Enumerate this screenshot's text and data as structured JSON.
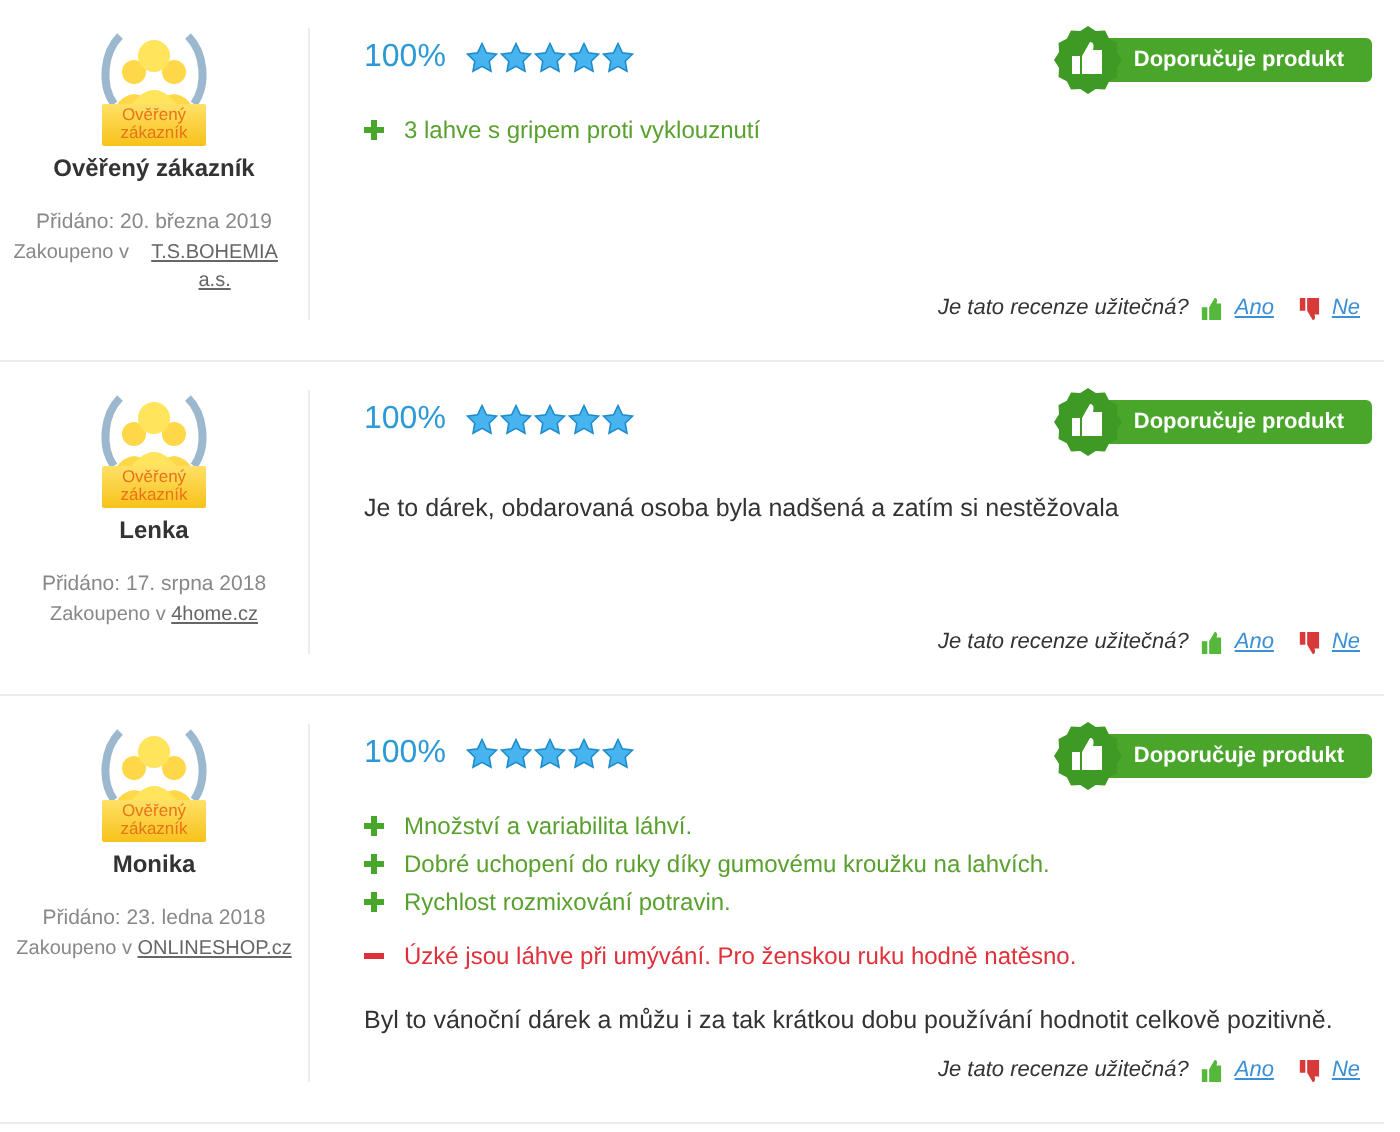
{
  "reviews": [
    {
      "badge_label": "Ověřený zákazník",
      "name": "Ověřený zákazník",
      "added": "Přidáno: 20. března 2019",
      "shop_prefix": "Zakoupeno v",
      "shop": "T.S.BOHEMIA a.s.",
      "score": "100%",
      "stars": 5,
      "recommend": "Doporučuje produkt",
      "points": [
        {
          "kind": "pro",
          "text": "3 lahve s gripem proti vyklouznutí"
        }
      ],
      "helpful": {
        "question": "Je tato recenze užitečná?",
        "yes": "Ano",
        "no": "Ne"
      }
    },
    {
      "badge_label": "Ověřený zákazník",
      "name": "Lenka",
      "added": "Přidáno: 17. srpna 2018",
      "shop_prefix": "Zakoupeno v",
      "shop": "4home.cz",
      "score": "100%",
      "stars": 5,
      "recommend": "Doporučuje produkt",
      "text": "Je to dárek, obdarovaná osoba byla nadšená a zatím si nestěžovala",
      "helpful": {
        "question": "Je tato recenze užitečná?",
        "yes": "Ano",
        "no": "Ne"
      }
    },
    {
      "badge_label": "Ověřený zákazník",
      "name": "Monika",
      "added": "Přidáno: 23. ledna 2018",
      "shop_prefix": "Zakoupeno v",
      "shop": "ONLINESHOP.cz",
      "score": "100%",
      "stars": 5,
      "recommend": "Doporučuje produkt",
      "points": [
        {
          "kind": "pro",
          "text": "Množství a variabilita láhví."
        },
        {
          "kind": "pro",
          "text": "Dobré uchopení do ruky díky gumovému kroužku na lahvích."
        },
        {
          "kind": "pro",
          "text": "Rychlost rozmixování potravin."
        },
        {
          "kind": "con",
          "text": "Úzké jsou láhve při umývání. Pro ženskou ruku hodně natěsno."
        }
      ],
      "text": "Byl to vánoční dárek a můžu i za tak krátkou dobu používání hodnotit celkově pozitivně.",
      "helpful": {
        "question": "Je tato recenze užitečná?",
        "yes": "Ano",
        "no": "Ne"
      }
    }
  ]
}
